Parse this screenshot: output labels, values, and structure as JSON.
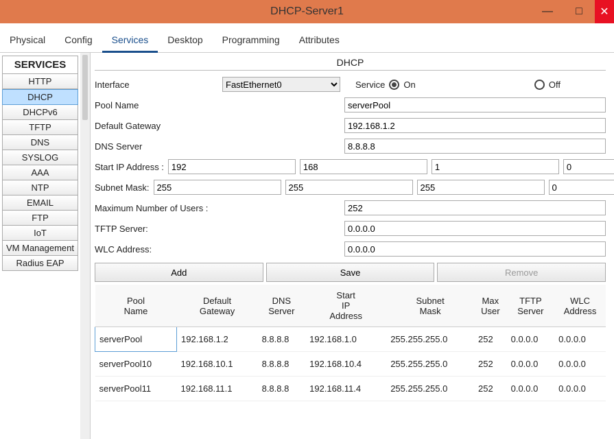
{
  "window": {
    "title": "DHCP-Server1",
    "minimize": "—",
    "restore": "□",
    "close": "✕"
  },
  "tabs": {
    "physical": "Physical",
    "config": "Config",
    "services": "Services",
    "desktop": "Desktop",
    "programming": "Programming",
    "attributes": "Attributes",
    "active": "services"
  },
  "sidebar": {
    "header": "SERVICES",
    "items": [
      "HTTP",
      "DHCP",
      "DHCPv6",
      "TFTP",
      "DNS",
      "SYSLOG",
      "AAA",
      "NTP",
      "EMAIL",
      "FTP",
      "IoT",
      "VM Management",
      "Radius EAP"
    ],
    "active_index": 1
  },
  "panel": {
    "title": "DHCP",
    "labels": {
      "interface": "Interface",
      "service": "Service",
      "on": "On",
      "off": "Off",
      "pool_name": "Pool Name",
      "default_gateway": "Default Gateway",
      "dns_server": "DNS Server",
      "start_ip": "Start IP Address :",
      "subnet_mask": "Subnet Mask:",
      "max_users": "Maximum Number of Users :",
      "tftp_server": "TFTP Server:",
      "wlc_address": "WLC Address:"
    },
    "values": {
      "interface": "FastEthernet0",
      "service_on": true,
      "pool_name": "serverPool",
      "default_gateway": "192.168.1.2",
      "dns_server": "8.8.8.8",
      "start_ip": [
        "192",
        "168",
        "1",
        "0"
      ],
      "subnet_mask": [
        "255",
        "255",
        "255",
        "0"
      ],
      "max_users": "252",
      "tftp_server": "0.0.0.0",
      "wlc_address": "0.0.0.0"
    },
    "buttons": {
      "add": "Add",
      "save": "Save",
      "remove": "Remove"
    }
  },
  "table": {
    "columns": [
      "Pool\nName",
      "Default\nGateway",
      "DNS\nServer",
      "Start\nIP\nAddress",
      "Subnet\nMask",
      "Max\nUser",
      "TFTP\nServer",
      "WLC\nAddress"
    ],
    "rows": [
      {
        "pool": "serverPool",
        "gw": "192.168.1.2",
        "dns": "8.8.8.8",
        "start": "192.168.1.0",
        "mask": "255.255.255.0",
        "max": "252",
        "tftp": "0.0.0.0",
        "wlc": "0.0.0.0"
      },
      {
        "pool": "serverPool10",
        "gw": "192.168.10.1",
        "dns": "8.8.8.8",
        "start": "192.168.10.4",
        "mask": "255.255.255.0",
        "max": "252",
        "tftp": "0.0.0.0",
        "wlc": "0.0.0.0"
      },
      {
        "pool": "serverPool11",
        "gw": "192.168.11.1",
        "dns": "8.8.8.8",
        "start": "192.168.11.4",
        "mask": "255.255.255.0",
        "max": "252",
        "tftp": "0.0.0.0",
        "wlc": "0.0.0.0"
      }
    ]
  }
}
